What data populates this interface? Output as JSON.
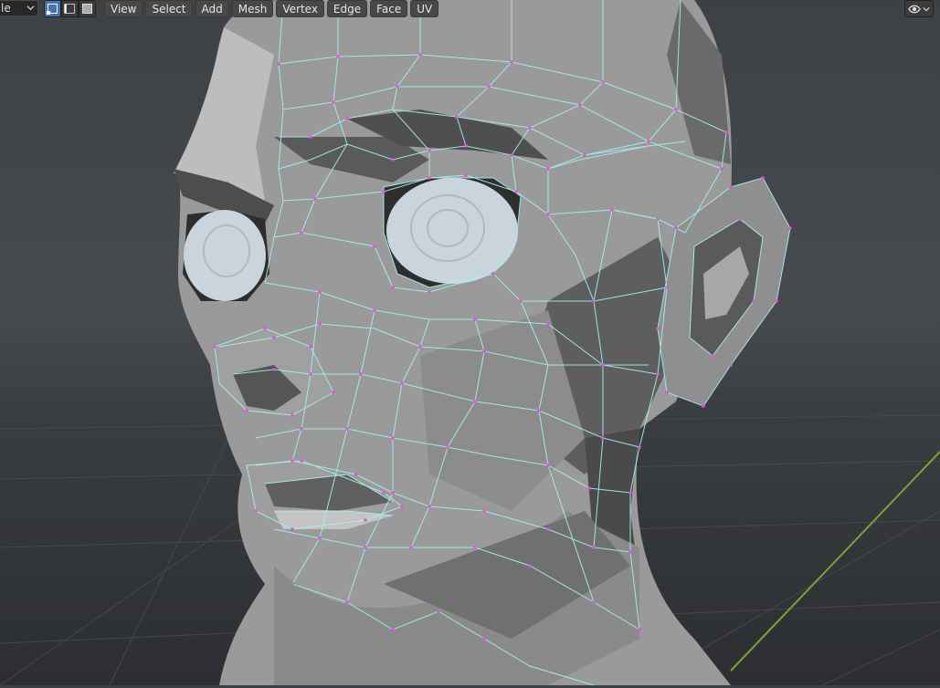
{
  "header": {
    "mode_label": "le",
    "select_modes": [
      {
        "name": "vertex-select-mode",
        "active": true
      },
      {
        "name": "edge-select-mode",
        "active": false
      },
      {
        "name": "face-select-mode",
        "active": false
      }
    ],
    "menus": [
      "View",
      "Select",
      "Add",
      "Mesh",
      "Vertex",
      "Edge",
      "Face",
      "UV"
    ],
    "visibility_icon": "eye-icon",
    "chevron_icon": "chevron-down-icon"
  },
  "viewport": {
    "object": "head-mesh",
    "colors": {
      "wire": "#a8f0f0",
      "vertex": "#e055e0",
      "grid_axis_y": "#7ca232",
      "mesh_light": "#a6a6a6",
      "mesh_dark": "#505050",
      "eye": "#c9d4dc"
    }
  }
}
